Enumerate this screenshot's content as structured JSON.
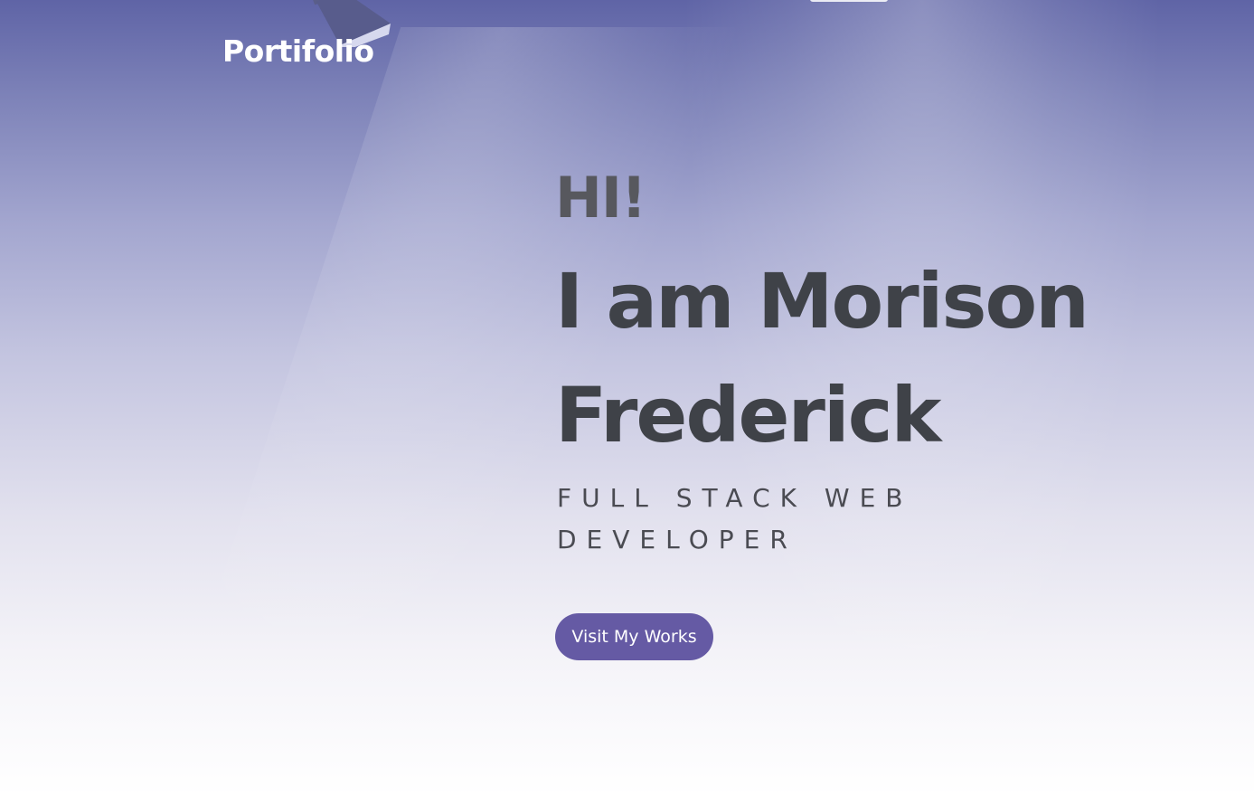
{
  "header": {
    "logo_text": "Portifolio"
  },
  "hero": {
    "greeting": "HI!",
    "name": "I am Morison Frederick",
    "role": "FULL STACK WEB DEVELOPER",
    "cta_label": "Visit My Works"
  },
  "colors": {
    "accent": "#655aa4",
    "heading": "#3f4248",
    "background_top": "#5f64a6",
    "background_bottom": "#ffffff"
  },
  "icons": {
    "lamp_left": "spotlight-lamp-icon",
    "lamp_right": "spotlight-lamp-icon"
  }
}
